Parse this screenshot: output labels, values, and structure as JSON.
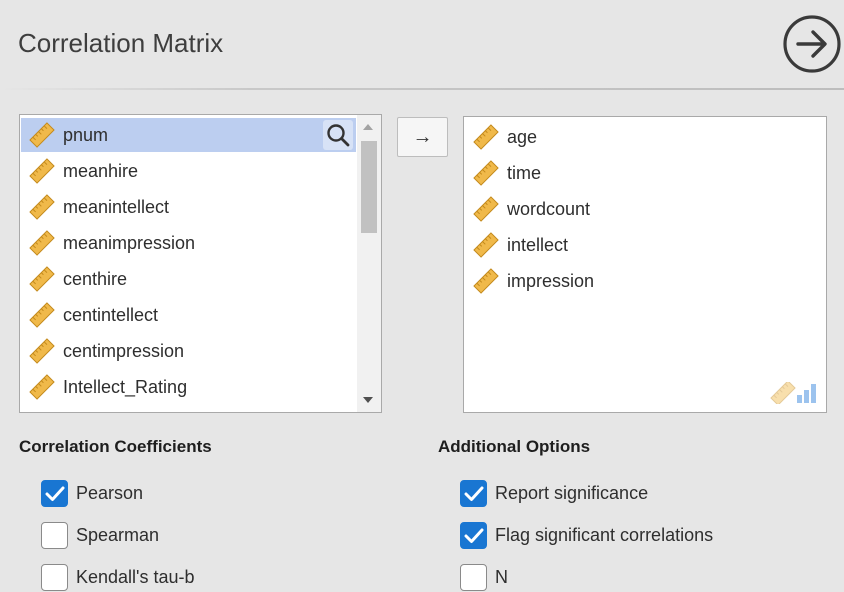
{
  "header": {
    "title": "Correlation Matrix"
  },
  "source_list": {
    "items": [
      {
        "label": "pnum",
        "selected": true
      },
      {
        "label": "meanhire"
      },
      {
        "label": "meanintellect"
      },
      {
        "label": "meanimpression"
      },
      {
        "label": "centhire"
      },
      {
        "label": "centintellect"
      },
      {
        "label": "centimpression"
      },
      {
        "label": "Intellect_Rating"
      }
    ]
  },
  "move_button": {
    "label": "→"
  },
  "target_list": {
    "items": [
      {
        "label": "age"
      },
      {
        "label": "time"
      },
      {
        "label": "wordcount"
      },
      {
        "label": "intellect"
      },
      {
        "label": "impression"
      }
    ]
  },
  "correlation_coefficients": {
    "title": "Correlation Coefficients",
    "options": [
      {
        "label": "Pearson",
        "checked": true
      },
      {
        "label": "Spearman",
        "checked": false
      },
      {
        "label": "Kendall's tau-b",
        "checked": false
      }
    ]
  },
  "additional_options": {
    "title": "Additional Options",
    "options": [
      {
        "label": "Report significance",
        "checked": true
      },
      {
        "label": "Flag significant correlations",
        "checked": true
      },
      {
        "label": "N",
        "checked": false
      }
    ]
  },
  "colors": {
    "selected_row": "#bccef0",
    "checkbox_checked": "#1976d2",
    "ruler_icon": "#f0b94a"
  }
}
